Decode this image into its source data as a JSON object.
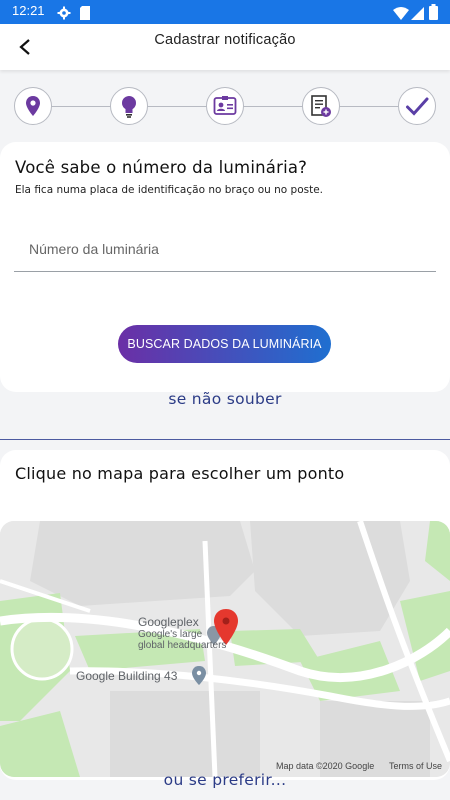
{
  "status_bar": {
    "time": "12:21",
    "icons": [
      "settings-icon",
      "sim-card-icon",
      "wifi-icon",
      "signal-icon",
      "battery-icon"
    ],
    "color": "#1976e6"
  },
  "app_bar": {
    "title": "Cadastrar notificação",
    "back_icon": "back-arrow-icon"
  },
  "stepper": {
    "steps": [
      "location-pin-icon",
      "light-bulb-icon",
      "id-card-icon",
      "document-add-icon",
      "check-icon"
    ],
    "active_color": "#6c3aa0"
  },
  "luminaire_section": {
    "question": "Você sabe o número da luminária?",
    "hint": "Ela fica numa placa de identificação no braço ou no poste.",
    "input_placeholder": "Número da luminária",
    "input_value": "",
    "button_label": "BUSCAR DADOS DA LUMINÁRIA"
  },
  "alt_link_1": "se não souber",
  "map_section": {
    "question": "Clique no mapa para escolher um ponto",
    "labels": {
      "place_name": "Googleplex",
      "place_desc_line1": "Google's large",
      "place_desc_line2": "global headquarters",
      "building": "Google Building 43"
    },
    "attribution": "Map data ©2020 Google",
    "terms": "Terms of Use"
  },
  "alt_link_2": "ou se preferir..."
}
